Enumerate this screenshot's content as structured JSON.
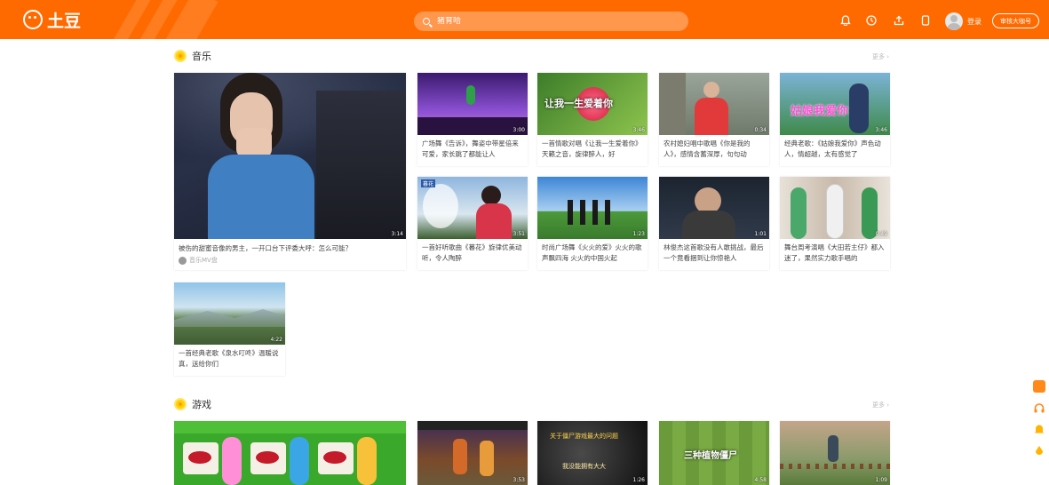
{
  "header": {
    "logo_text": "土豆",
    "search_placeholder": "猪育哈",
    "login_label": "登录",
    "uploader_label": "审核大咖号",
    "colors": {
      "brand": "#ff6a00"
    },
    "icons": [
      "bell-icon",
      "history-icon",
      "upload-icon",
      "phone-icon"
    ]
  },
  "sections": [
    {
      "title": "音乐",
      "more": "更多 ›"
    },
    {
      "title": "游戏",
      "more": "更多 ›"
    }
  ],
  "music": {
    "featured": {
      "title": "被伤的甜蜜音像的男主，一开口台下评委大呼：怎么可能？",
      "author": "音乐MV盘",
      "duration": "3:14"
    },
    "grid": [
      {
        "title": "广场舞《告诉》，舞姿中带星倍来可爱，家长跳了都能让人",
        "duration": "3:00"
      },
      {
        "title": "一首情歌对唱《让我一生爱着你》天籁之音，旋律醉人，好",
        "duration": "3:46"
      },
      {
        "title": "农村媳妇唱中歌唱《你是我的人》，感情含蓄深厚，句句动",
        "duration": "0:34"
      },
      {
        "title": "经典老歌：《姑娘我爱你》声色动人，情超越，太有感觉了",
        "duration": "3:46"
      },
      {
        "title": "一首好听歌曲《暮花》旋律优美动听，令人陶醉",
        "duration": "3:51"
      },
      {
        "title": "时尚广场舞《火火的爱》火火的歌声飘四海 火火的中国火起",
        "duration": "1:23"
      },
      {
        "title": "林俊杰这首歌没有人敢挑战，最后一个竟看捆到让你惊艳人",
        "duration": "1:01"
      },
      {
        "title": "舞台周考演唱《大田若主仔》都入迷了，果然实力歌手唱的",
        "duration": "0:49"
      },
      {
        "title": "一首经典老歌《泉水叮咚》温暖说真，送给你们",
        "duration": "4:22"
      }
    ],
    "overlays": [
      "让我一生爱着你",
      "姑娘我爱你",
      "暮花"
    ]
  },
  "games": {
    "grid": [
      {
        "duration": ""
      },
      {
        "duration": "3:53"
      },
      {
        "duration": "1:26",
        "overlay_top": "关于僵尸游戏最大的问题",
        "overlay_bottom": "我没能拥有大大"
      },
      {
        "duration": "4:58",
        "overlay": "三种植物僵尸"
      },
      {
        "duration": "1:09"
      }
    ]
  }
}
